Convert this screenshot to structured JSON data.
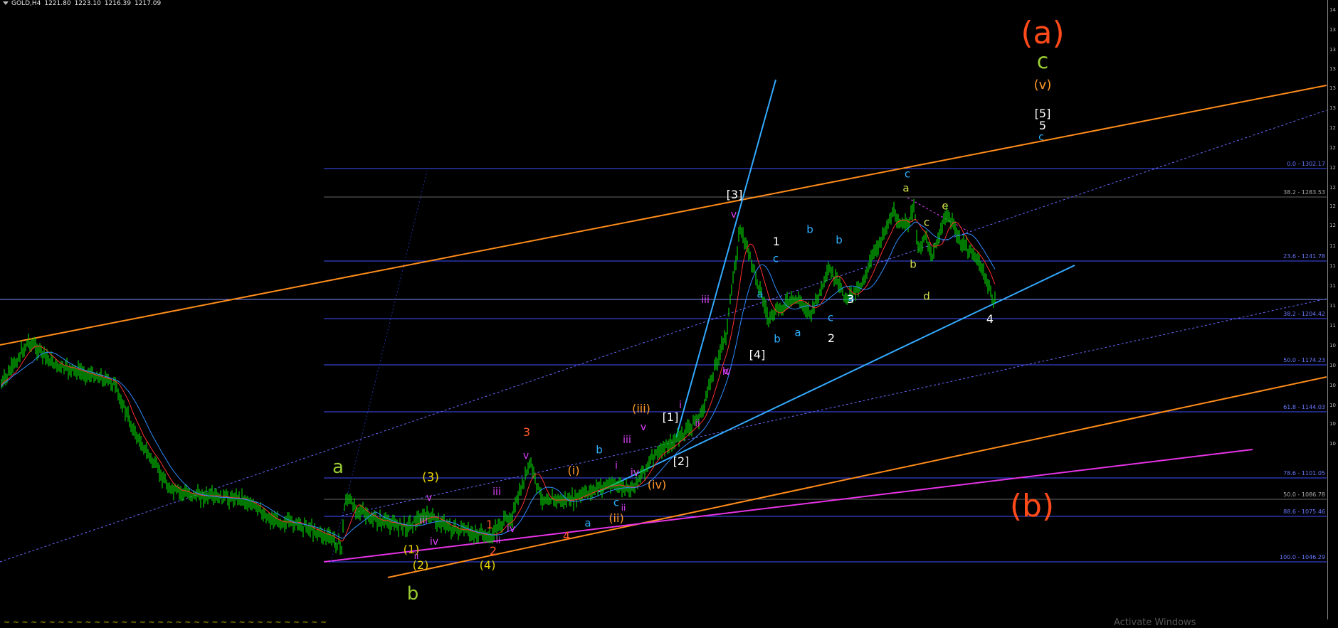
{
  "header": {
    "symbol": "GOLD,H4",
    "open": "1221.80",
    "high": "1223.10",
    "low": "1216.39",
    "close": "1217.09"
  },
  "price_axis_ticks": [
    "14",
    "13",
    "13",
    "13",
    "13",
    "13",
    "12",
    "12",
    "12",
    "12",
    "12",
    "12",
    "11",
    "11",
    "11",
    "11",
    "11",
    "10",
    "10",
    "10",
    "10",
    "10",
    "10"
  ],
  "fib_levels": [
    {
      "label": "0.0 - 1302.17",
      "color": "#6a78ff"
    },
    {
      "label": "38.2 - 1283.53",
      "color": "#aaaaaa"
    },
    {
      "label": "23.6 - 1241.78",
      "color": "#6a78ff"
    },
    {
      "label": "38.2 - 1204.42",
      "color": "#6a78ff"
    },
    {
      "label": "50.0 - 1174.23",
      "color": "#6a78ff"
    },
    {
      "label": "61.8 - 1144.03",
      "color": "#6a78ff"
    },
    {
      "label": "78.6 - 1101.05",
      "color": "#6a78ff"
    },
    {
      "label": "50.0 - 1086.78",
      "color": "#aaaaaa"
    },
    {
      "label": "88.6 - 1075.46",
      "color": "#6a78ff"
    },
    {
      "label": "100.0 - 1046.29",
      "color": "#6a78ff"
    }
  ],
  "wave_labels": [
    {
      "text": "(a)",
      "color": "#ff4a1a",
      "size": 44
    },
    {
      "text": "c",
      "color": "#9acd32",
      "size": 30
    },
    {
      "text": "(v)",
      "color": "#ff9a2a",
      "size": 18
    },
    {
      "text": "[5]",
      "color": "#ffffff",
      "size": 16
    },
    {
      "text": "5",
      "color": "#ffffff",
      "size": 16
    },
    {
      "text": "c",
      "color": "#2eb0ff",
      "size": 14
    },
    {
      "text": "(b)",
      "color": "#ff4a1a",
      "size": 44
    },
    {
      "text": "a",
      "color": "#9acd32",
      "size": 26
    },
    {
      "text": "b",
      "color": "#9acd32",
      "size": 26
    },
    {
      "text": "(3)",
      "color": "#e8d200",
      "size": 17
    },
    {
      "text": "v",
      "color": "#e040ff",
      "size": 14
    },
    {
      "text": "iii",
      "color": "#e040ff",
      "size": 14
    },
    {
      "text": "iv",
      "color": "#e040ff",
      "size": 14
    },
    {
      "text": "(1)",
      "color": "#e8d200",
      "size": 16
    },
    {
      "text": "(2)",
      "color": "#e8d200",
      "size": 16
    },
    {
      "text": "ii",
      "color": "#e040ff",
      "size": 12
    },
    {
      "text": "(4)",
      "color": "#e8d200",
      "size": 16
    },
    {
      "text": "1",
      "color": "#ff5a2a",
      "size": 16
    },
    {
      "text": "2",
      "color": "#ff5a2a",
      "size": 16
    },
    {
      "text": "3",
      "color": "#ff5a2a",
      "size": 16
    },
    {
      "text": "4",
      "color": "#ff5a2a",
      "size": 16
    },
    {
      "text": "v",
      "color": "#e040ff",
      "size": 14
    },
    {
      "text": "iii",
      "color": "#e040ff",
      "size": 14
    },
    {
      "text": "iv",
      "color": "#e040ff",
      "size": 14
    },
    {
      "text": "ii",
      "color": "#e040ff",
      "size": 12
    },
    {
      "text": "(i)",
      "color": "#ff9a2a",
      "size": 16
    },
    {
      "text": "(ii)",
      "color": "#ff9a2a",
      "size": 16
    },
    {
      "text": "(iii)",
      "color": "#ff9a2a",
      "size": 16
    },
    {
      "text": "(iv)",
      "color": "#ff9a2a",
      "size": 16
    },
    {
      "text": "a",
      "color": "#2eb0ff",
      "size": 15
    },
    {
      "text": "b",
      "color": "#2eb0ff",
      "size": 15
    },
    {
      "text": "c",
      "color": "#2eb0ff",
      "size": 15
    },
    {
      "text": "i",
      "color": "#e040ff",
      "size": 14
    },
    {
      "text": "ii",
      "color": "#e040ff",
      "size": 12
    },
    {
      "text": "iii",
      "color": "#e040ff",
      "size": 14
    },
    {
      "text": "iv",
      "color": "#e040ff",
      "size": 14
    },
    {
      "text": "v",
      "color": "#e040ff",
      "size": 14
    },
    {
      "text": "[1]",
      "color": "#ffffff",
      "size": 16
    },
    {
      "text": "[2]",
      "color": "#ffffff",
      "size": 16
    },
    {
      "text": "i",
      "color": "#e040ff",
      "size": 14
    },
    {
      "text": "ii",
      "color": "#e040ff",
      "size": 13
    },
    {
      "text": "iii",
      "color": "#e040ff",
      "size": 14
    },
    {
      "text": "iv",
      "color": "#e040ff",
      "size": 14
    },
    {
      "text": "v",
      "color": "#e040ff",
      "size": 14
    },
    {
      "text": "v",
      "color": "#e040ff",
      "size": 14
    },
    {
      "text": "[3]",
      "color": "#ffffff",
      "size": 16
    },
    {
      "text": "[4]",
      "color": "#ffffff",
      "size": 16
    },
    {
      "text": "a",
      "color": "#2eb0ff",
      "size": 15
    },
    {
      "text": "b",
      "color": "#2eb0ff",
      "size": 15
    },
    {
      "text": "1",
      "color": "#ffffff",
      "size": 16
    },
    {
      "text": "c",
      "color": "#2eb0ff",
      "size": 15
    },
    {
      "text": "a",
      "color": "#2eb0ff",
      "size": 15
    },
    {
      "text": "b",
      "color": "#2eb0ff",
      "size": 15
    },
    {
      "text": "c",
      "color": "#2eb0ff",
      "size": 15
    },
    {
      "text": "2",
      "color": "#ffffff",
      "size": 16
    },
    {
      "text": "a",
      "color": "#2eb0ff",
      "size": 15
    },
    {
      "text": "b",
      "color": "#2eb0ff",
      "size": 15
    },
    {
      "text": "3",
      "color": "#ffffff",
      "size": 16
    },
    {
      "text": "c",
      "color": "#2eb0ff",
      "size": 15
    },
    {
      "text": "a",
      "color": "#d4e04a",
      "size": 15
    },
    {
      "text": "b",
      "color": "#d4e04a",
      "size": 15
    },
    {
      "text": "c",
      "color": "#d4e04a",
      "size": 15
    },
    {
      "text": "d",
      "color": "#d4e04a",
      "size": 15
    },
    {
      "text": "e",
      "color": "#d4e04a",
      "size": 15
    },
    {
      "text": "4",
      "color": "#ffffff",
      "size": 16
    }
  ],
  "bottom_strip_text": "~ ~  ~  ~ ~  ~ ~  ~  ~  ~  ~  ~  ~  ~ ~ ~  ~  ~ ~  ~  ~  ~ ~  ~  ~  ~  ~  ~  ~  ~  ~  ~  ~  ~  ~  ~",
  "watermark": "Activate Windows",
  "colors": {
    "candle": "#00c800",
    "ma_fast": "#ff3030",
    "ma_slow": "#2f8cff",
    "fib_line": "#4050ff",
    "channel_orange": "#ff8c1a",
    "channel_dashed": "#6a6aff",
    "trend_blue": "#33aaff",
    "trend_magenta": "#e633e6"
  }
}
